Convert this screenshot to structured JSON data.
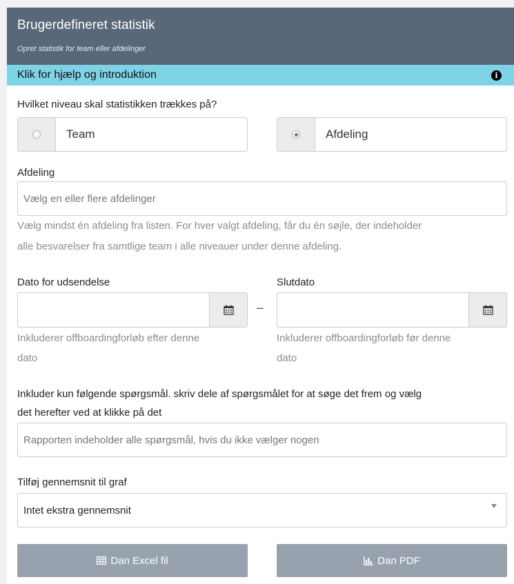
{
  "header": {
    "title": "Brugerdefineret statistik",
    "subtitle": "Opret statistik for team eller afdelinger"
  },
  "help": {
    "label": "Klik for hjælp og introduktion",
    "icon": "info-icon"
  },
  "level": {
    "question": "Hvilket niveau skal statistikken trækkes på?",
    "options": [
      {
        "label": "Team",
        "checked": false
      },
      {
        "label": "Afdeling",
        "checked": true
      }
    ]
  },
  "department": {
    "label": "Afdeling",
    "placeholder": "Vælg en eller flere afdelinger",
    "hint_line1": "Vælg mindst én afdeling fra listen. For hver valgt afdeling, får du én søjle, der indeholder",
    "hint_line2": "alle besvarelser fra samtlige team i alle niveauer under denne afdeling."
  },
  "dates": {
    "start_label": "Dato for udsendelse",
    "start_hint_line1": "Inkluderer offboardingforløb efter denne",
    "start_hint_line2": "dato",
    "separator": "–",
    "end_label": "Slutdato",
    "end_hint_line1": "Inkluderer offboardingforløb før denne",
    "end_hint_line2": "dato",
    "icon": "calendar-icon"
  },
  "questions": {
    "label_line1": "Inkluder kun følgende spørgsmål. skriv dele af spørgsmålet for at søge det frem og vælg",
    "label_line2": "det herefter ved at klikke på det",
    "placeholder": "Rapporten indeholder alle spørgsmål, hvis du ikke vælger nogen"
  },
  "average": {
    "label": "Tilføj gennemsnit til graf",
    "selected": "Intet ekstra gennemsnit"
  },
  "buttons": {
    "excel": "Dan Excel fil",
    "pdf": "Dan PDF"
  },
  "colors": {
    "header_bg": "#59677a",
    "help_bg": "#7ed3e6",
    "button_bg": "#98a2ae"
  }
}
